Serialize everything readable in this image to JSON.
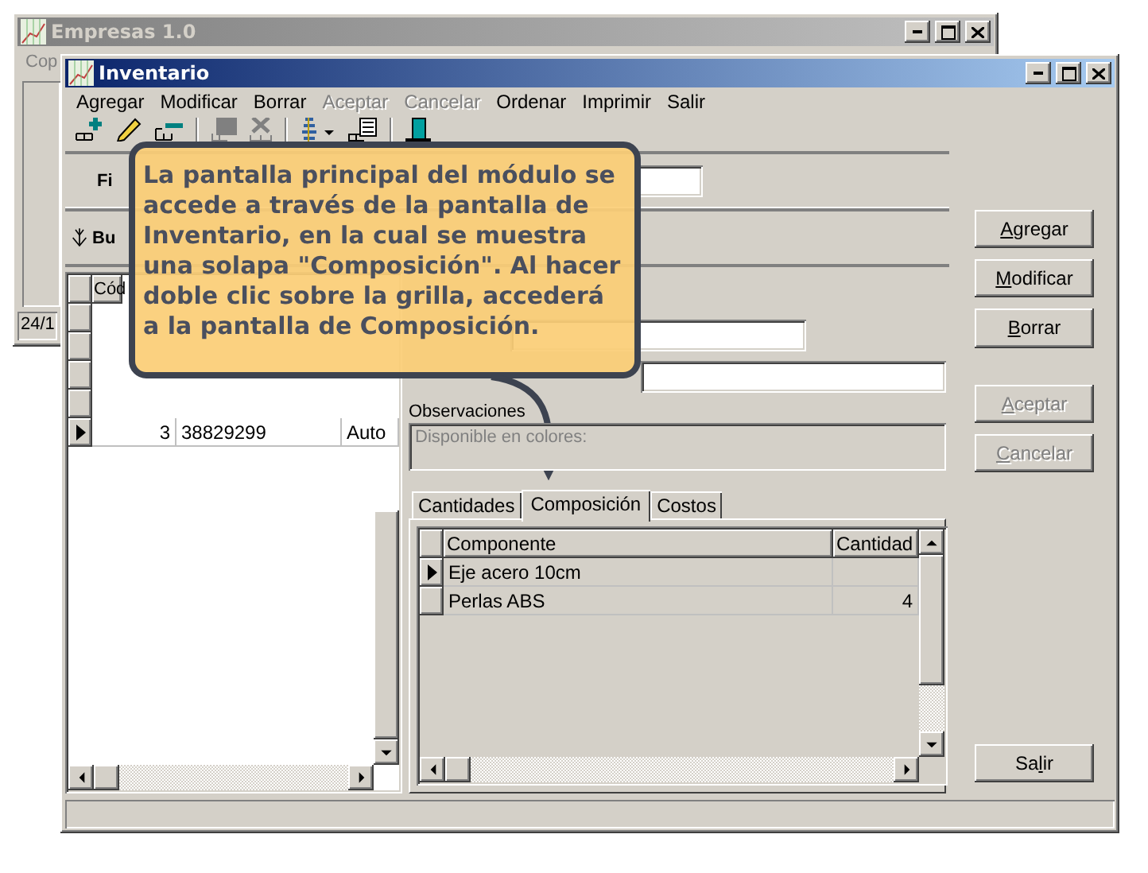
{
  "background_window": {
    "title": "Empresas 1.0",
    "menu_item": "Cop",
    "status": "24/1"
  },
  "window": {
    "title": "Inventario"
  },
  "menu": [
    {
      "label": "Agregar",
      "disabled": false
    },
    {
      "label": "Modificar",
      "disabled": false
    },
    {
      "label": "Borrar",
      "disabled": false
    },
    {
      "label": "Aceptar",
      "disabled": true
    },
    {
      "label": "Cancelar",
      "disabled": true
    },
    {
      "label": "Ordenar",
      "disabled": false
    },
    {
      "label": "Imprimir",
      "disabled": false
    },
    {
      "label": "Salir",
      "disabled": false
    }
  ],
  "toolbar": [
    {
      "kind": "add",
      "disabled": false
    },
    {
      "kind": "edit",
      "disabled": false
    },
    {
      "kind": "remove",
      "disabled": false
    },
    {
      "kind": "separator"
    },
    {
      "kind": "save",
      "disabled": true
    },
    {
      "kind": "cancel",
      "disabled": true
    },
    {
      "kind": "separator"
    },
    {
      "kind": "sort",
      "disabled": false
    },
    {
      "kind": "print",
      "disabled": false
    },
    {
      "kind": "separator"
    },
    {
      "kind": "exit",
      "disabled": false
    }
  ],
  "filter": {
    "filter_label": "Fi",
    "search_label": "Bu"
  },
  "list_grid": {
    "columns": [
      "Cód"
    ],
    "rows": [
      {
        "column_1": "3",
        "column_2": "38829299",
        "column_3": "Auto",
        "selected": true
      }
    ]
  },
  "form": {
    "observations_label": "Observaciones",
    "observations_value": "Disponible en colores:"
  },
  "tabs": [
    {
      "label": "Cantidades",
      "selected": false
    },
    {
      "label": "Composición",
      "selected": true
    },
    {
      "label": "Costos",
      "selected": false
    }
  ],
  "components_grid": {
    "columns": [
      "Componente",
      "Cantidad"
    ],
    "rows": [
      {
        "componente": "Eje acero 10cm",
        "selected": true
      },
      {
        "componente": "Perlas ABS",
        "cantidad": "4",
        "selected": false
      }
    ]
  },
  "buttons": [
    {
      "label": "Agregar",
      "disabled": false
    },
    {
      "label": "Modificar",
      "disabled": false
    },
    {
      "label": "Borrar",
      "disabled": false
    },
    {
      "label": "Aceptar",
      "disabled": true
    },
    {
      "label": "Cancelar",
      "disabled": true
    },
    {
      "label": "Salir",
      "disabled": false
    }
  ],
  "callout": {
    "text": "La pantalla principal del módulo se accede a través de la pantalla de Inventario, en la cual se muestra una solapa \"Composición\". Al hacer doble clic sobre la grilla, accederá a la pantalla de Composición."
  }
}
